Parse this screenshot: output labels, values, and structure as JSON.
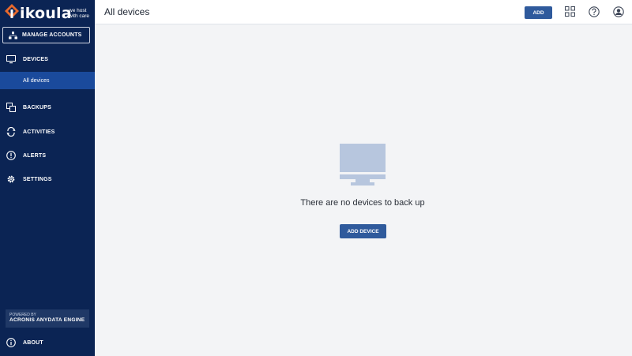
{
  "brand": {
    "name": "ikoula",
    "tagline_line1": "we host",
    "tagline_line2": "with care"
  },
  "sidebar": {
    "manage_accounts": "MANAGE ACCOUNTS",
    "items": [
      {
        "label": "DEVICES",
        "icon": "monitor-icon"
      },
      {
        "label": "BACKUPS",
        "icon": "backups-icon"
      },
      {
        "label": "ACTIVITIES",
        "icon": "activities-icon"
      },
      {
        "label": "ALERTS",
        "icon": "alert-icon"
      },
      {
        "label": "SETTINGS",
        "icon": "gear-icon"
      }
    ],
    "sub_item": "All devices",
    "powered_by": "POWERED BY",
    "engine": "ACRONIS ANYDATA ENGINE",
    "about": "ABOUT"
  },
  "header": {
    "title": "All devices",
    "add_label": "ADD",
    "icons": [
      "grid-icon",
      "help-icon",
      "account-icon"
    ]
  },
  "main": {
    "empty_message": "There are no devices to back up",
    "add_device_label": "ADD DEVICE"
  },
  "colors": {
    "sidebar": "#0b2454",
    "selected": "#1a4a9c",
    "button": "#2f5a9c",
    "logo_orange": "#e8692c",
    "illustration": "#b7c6de"
  }
}
